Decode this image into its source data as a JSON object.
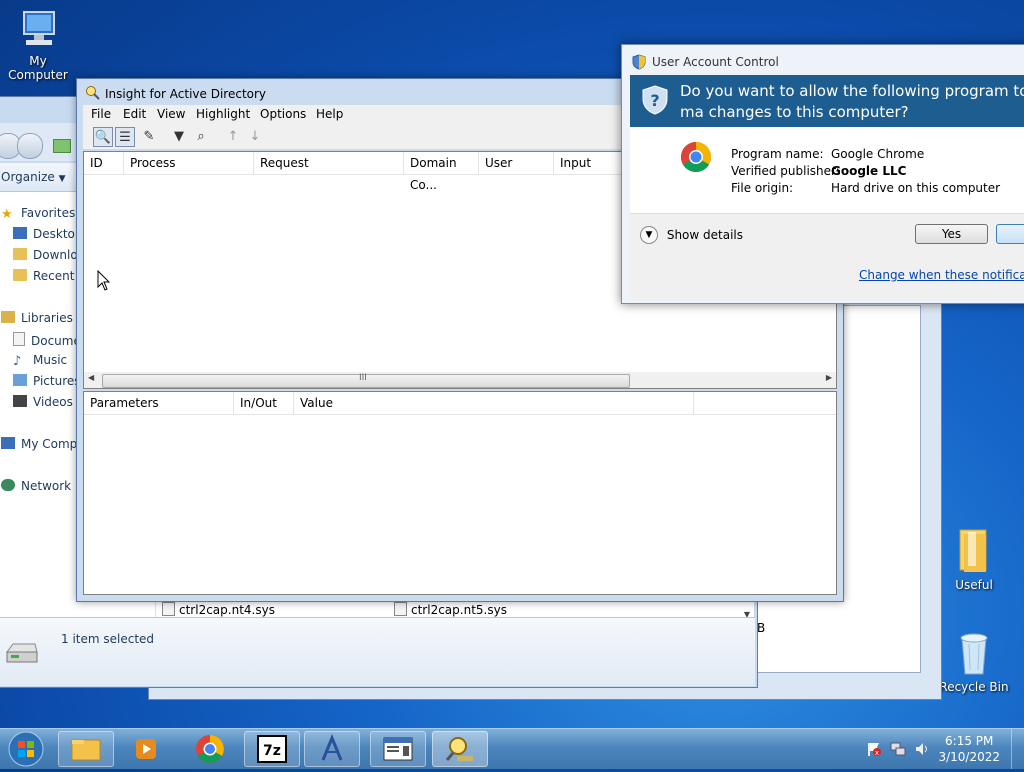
{
  "desktop": {
    "icons": [
      {
        "label": "My Computer"
      },
      {
        "label": "Useful"
      },
      {
        "label": "Recycle Bin"
      }
    ]
  },
  "explorer": {
    "organize_label": "Organize",
    "nav": {
      "favorites": "Favorites",
      "desktop": "Desktop",
      "downloads": "Downloa",
      "recent": "Recent P",
      "libraries": "Libraries",
      "documents": "Docume",
      "music": "Music",
      "pictures": "Pictures",
      "videos": "Videos",
      "my_computer": "My Comp",
      "network": "Network"
    },
    "files": [
      "ctrl2cap.nt4.sys",
      "ctrl2cap.nt5.sys"
    ],
    "status": "1 item selected",
    "size_suffix": "B"
  },
  "insight": {
    "title": "Insight for Active Directory",
    "menu": [
      "File",
      "Edit",
      "View",
      "Highlight",
      "Options",
      "Help"
    ],
    "columns_top": [
      "ID",
      "Process",
      "Request",
      "Domain Co...",
      "User",
      "Input"
    ],
    "scroll_grip": "III",
    "columns_bottom": [
      "Parameters",
      "In/Out",
      "Value"
    ]
  },
  "uac": {
    "title": "User Account Control",
    "question": "Do you want to allow the following program to ma changes to this computer?",
    "program_name_label": "Program name:",
    "program_name_value": "Google Chrome",
    "publisher_label": "Verified publisher:",
    "publisher_value": "Google LLC",
    "origin_label": "File origin:",
    "origin_value": "Hard drive on this computer",
    "show_details": "Show details",
    "yes_label": "Yes",
    "change_link": "Change when these notification"
  },
  "taskbar": {
    "time": "6:15 PM",
    "date": "3/10/2022"
  },
  "colors": {
    "uac_banner": "#1e5d8f",
    "link": "#0645ad"
  }
}
